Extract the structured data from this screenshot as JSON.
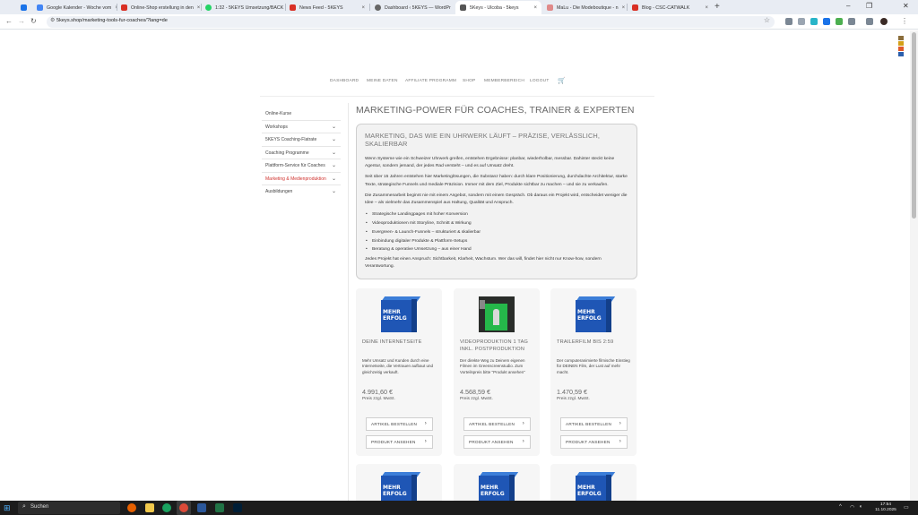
{
  "browser": {
    "tabs": [
      {
        "title": "",
        "color": "#1a73e8"
      },
      {
        "title": "Google Kalender - Woche vom",
        "color": "#4285f4"
      },
      {
        "title": "Online-Shop erstellung in den",
        "color": "#d93025"
      },
      {
        "title": "1:32 - 5KEYS Umsetzung/BACK",
        "color": "#25d366"
      },
      {
        "title": "News Feed - 5KEYS",
        "color": "#d93025"
      },
      {
        "title": "Dashboard ‹ 5KEYS — WordPr",
        "color": "#666666"
      },
      {
        "title": "5Keys - Ulcoba - 5keys",
        "color": "#555555"
      },
      {
        "title": "MaLu - Die Modeboutique - n",
        "color": "#e08a8a"
      },
      {
        "title": "Blog - CSC-CATWALK",
        "color": "#d93025"
      }
    ],
    "new_tab_label": "+",
    "url": "5keys.shop/marketing-tools-fur-coaches/?lang=de"
  },
  "site_nav": {
    "items": [
      "DASHBOARD",
      "MEINE DATEN",
      "AFFILIATE PROGRAMM",
      "SHOP",
      "MEMBERBEREICH",
      "LOGOUT"
    ],
    "cart_icon": "cart-icon"
  },
  "sidebar": {
    "items": [
      {
        "label": "Online-Kurse",
        "has_children": false
      },
      {
        "label": "Workshops",
        "has_children": true
      },
      {
        "label": "5KEYS Coaching-Flatrate",
        "has_children": true
      },
      {
        "label": "Coaching Programme",
        "has_children": true
      },
      {
        "label": "Plattform-Service für Coaches",
        "has_children": true
      },
      {
        "label": "Marketing & Medienproduktion",
        "has_children": true,
        "active": true
      },
      {
        "label": "Ausbildungen",
        "has_children": true
      }
    ],
    "active_color": "#d0312d"
  },
  "main": {
    "headline": "MARKETING-POWER FÜR COACHES, TRAINER & EXPERTEN",
    "intro_box": {
      "heading": "MARKETING, DAS WIE EIN UHRWERK LÄUFT – PRÄZISE, VERLÄSSLICH, SKALIERBAR",
      "p1": "Wenn Systeme wie ein Schweizer Uhrwerk greifen, entstehen Ergebnisse: planbar, wiederholbar, messbar. Dahinter steckt keine Agentur, sondern jemand, der jedes Rad versteht – und es auf Umsatz dreht.",
      "p2": "Seit über 15 Jahren entstehen hier Marketinglösungen, die Substanz haben: durch klare Positionierung, durchdachte Architektur, starke Texte, strategische Funnels und mediale Präzision. Immer mit dem Ziel, Produkte sichtbar zu machen – und sie zu verkaufen.",
      "p3": "Die Zusammenarbeit beginnt nie mit einem Angebot, sondern mit einem Gespräch. Ob daraus ein Projekt wird, entscheidet weniger die Idee – als vielmehr das Zusammenspiel aus Haltung, Qualität und Anspruch.",
      "bullets": [
        "Strategische Landingpages mit hoher Konversion",
        "Videoproduktionen mit Storyline, Schnitt & Wirkung",
        "Evergreen- & Launch-Funnels – strukturiert & skalierbar",
        "Einbindung digitaler Produkte & Plattform-Setups",
        "Beratung & operative Umsetzung – aus einer Hand"
      ],
      "p4": "Jedes Projekt hat einen Anspruch: Sichtbarkeit, Klarheit, Wachstum. Wer das will, findet hier nicht nur Know-how, sondern Verantwortung."
    },
    "products": [
      {
        "title": "DEINE INTERNETSEITE",
        "desc": "Mehr Umsatz und Kunden durch eine Internetseite, die Vertrauen aufbaut und gleichzeitig verkauft.",
        "price": "4.991,60 €",
        "vat": "Preis zzgl. MwSt.",
        "image": "mehr-erfolg-cube",
        "image_text": "MEHR ERFOLG"
      },
      {
        "title": "VIDEOPRODUKTION 1 TAG INKL. POSTPRODUKTION",
        "desc": "Der direkte Weg zu Deinem eigenen Filmen im Greenscreenstudio. Zum Vorteilspreis bitte \"Produkt ansehen\"",
        "price": "4.568,59 €",
        "vat": "Preis zzgl. MwSt.",
        "image": "greenscreen-studio-photo",
        "image_text": ""
      },
      {
        "title": "TRAILERFILM BIS 2:59",
        "desc": "Der computeranimierte filmische Einstieg für DEINEN Film, der Lust auf mehr macht.",
        "price": "1.470,59 €",
        "vat": "Preis zzgl. MwSt.",
        "image": "mehr-erfolg-cube",
        "image_text": "MEHR ERFOLG"
      }
    ],
    "buttons": {
      "order": "ARTIKEL BESTELLEN",
      "view": "PRODUKT ANSEHEN"
    },
    "partial_cards_image_text": "MEHR ERFOLG"
  },
  "taskbar": {
    "search_label": "Suchen",
    "time": "17:54",
    "date": "11.10.2025"
  }
}
